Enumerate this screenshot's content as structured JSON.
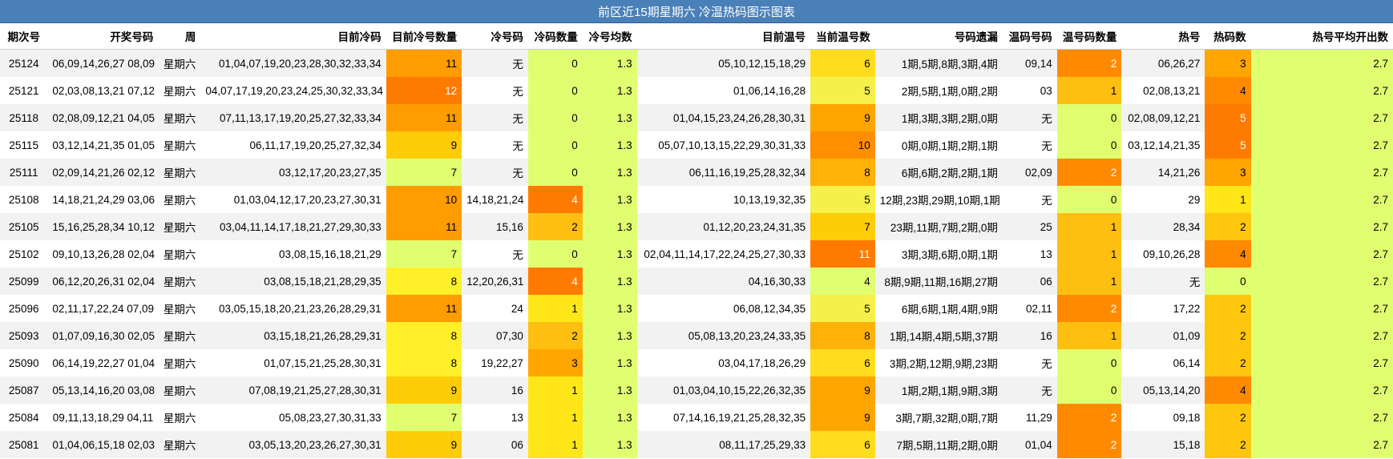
{
  "title": "前区近15期星期六 冷温热码图示图表",
  "headers": [
    "期次号",
    "开奖号码",
    "周",
    "目前冷码",
    "目前冷号数量",
    "冷号码",
    "冷码数量",
    "冷号均数",
    "目前温号",
    "当前温号数",
    "号码遗漏",
    "温码号码",
    "温号码数量",
    "热号",
    "热码数",
    "热号平均开出数"
  ],
  "colors": {
    "header_bg": "#4a80b8",
    "scale": {
      "0": "#e0ff70",
      "1": "#ffe619",
      "2": "#ffbf10",
      "3": "#ffa500",
      "4": "#ff8a00",
      "5": "#ff7b00",
      "6": "#ffdd1d",
      "7": "#e0ff70",
      "8": "#fff02a",
      "9": "#ffcc0a",
      "10": "#ff8f00",
      "11": "#ff9c00",
      "12": "#ff7900"
    },
    "avg_bg": "#e0ff70",
    "white_text_counts": [
      "12",
      "11_warm",
      "4_cold",
      "5_hot",
      "2_warm"
    ]
  },
  "rows": [
    {
      "issue": "25124",
      "draw": "06,09,14,26,27 08,09",
      "week": "星期六",
      "cold_codes": "01,04,07,19,20,23,28,30,32,33,34",
      "cold_count": "11",
      "cold_nums": "无",
      "cold_qty": "0",
      "cold_avg": "1.3",
      "warm_codes": "05,10,12,15,18,29",
      "warm_count": "6",
      "missing": "1期,5期,8期,3期,4期",
      "warm_nums": "09,14",
      "warm_qty": "2",
      "hot_nums": "06,26,27",
      "hot_count": "3",
      "hot_avg": "2.7"
    },
    {
      "issue": "25121",
      "draw": "02,03,08,13,21 07,12",
      "week": "星期六",
      "cold_codes": "04,07,17,19,20,23,24,25,30,32,33,34",
      "cold_count": "12",
      "cold_nums": "无",
      "cold_qty": "0",
      "cold_avg": "1.3",
      "warm_codes": "01,06,14,16,28",
      "warm_count": "5",
      "missing": "2期,5期,1期,0期,2期",
      "warm_nums": "03",
      "warm_qty": "1",
      "hot_nums": "02,08,13,21",
      "hot_count": "4",
      "hot_avg": "2.7"
    },
    {
      "issue": "25118",
      "draw": "02,08,09,12,21 04,05",
      "week": "星期六",
      "cold_codes": "07,11,13,17,19,20,25,27,32,33,34",
      "cold_count": "11",
      "cold_nums": "无",
      "cold_qty": "0",
      "cold_avg": "1.3",
      "warm_codes": "01,04,15,23,24,26,28,30,31",
      "warm_count": "9",
      "missing": "1期,3期,3期,2期,0期",
      "warm_nums": "无",
      "warm_qty": "0",
      "hot_nums": "02,08,09,12,21",
      "hot_count": "5",
      "hot_avg": "2.7"
    },
    {
      "issue": "25115",
      "draw": "03,12,14,21,35 01,05",
      "week": "星期六",
      "cold_codes": "06,11,17,19,20,25,27,32,34",
      "cold_count": "9",
      "cold_nums": "无",
      "cold_qty": "0",
      "cold_avg": "1.3",
      "warm_codes": "05,07,10,13,15,22,29,30,31,33",
      "warm_count": "10",
      "missing": "0期,0期,1期,2期,1期",
      "warm_nums": "无",
      "warm_qty": "0",
      "hot_nums": "03,12,14,21,35",
      "hot_count": "5",
      "hot_avg": "2.7"
    },
    {
      "issue": "25111",
      "draw": "02,09,14,21,26 02,12",
      "week": "星期六",
      "cold_codes": "03,12,17,20,23,27,35",
      "cold_count": "7",
      "cold_nums": "无",
      "cold_qty": "0",
      "cold_avg": "1.3",
      "warm_codes": "06,11,16,19,25,28,32,34",
      "warm_count": "8",
      "missing": "6期,6期,2期,2期,1期",
      "warm_nums": "02,09",
      "warm_qty": "2",
      "hot_nums": "14,21,26",
      "hot_count": "3",
      "hot_avg": "2.7"
    },
    {
      "issue": "25108",
      "draw": "14,18,21,24,29 03,06",
      "week": "星期六",
      "cold_codes": "01,03,04,12,17,20,23,27,30,31",
      "cold_count": "10",
      "cold_nums": "14,18,21,24",
      "cold_qty": "4",
      "cold_avg": "1.3",
      "warm_codes": "10,13,19,32,35",
      "warm_count": "5",
      "missing": "12期,23期,29期,10期,1期",
      "warm_nums": "无",
      "warm_qty": "0",
      "hot_nums": "29",
      "hot_count": "1",
      "hot_avg": "2.7"
    },
    {
      "issue": "25105",
      "draw": "15,16,25,28,34 10,12",
      "week": "星期六",
      "cold_codes": "03,04,11,14,17,18,21,27,29,30,33",
      "cold_count": "11",
      "cold_nums": "15,16",
      "cold_qty": "2",
      "cold_avg": "1.3",
      "warm_codes": "01,12,20,23,24,31,35",
      "warm_count": "7",
      "missing": "23期,11期,7期,2期,0期",
      "warm_nums": "25",
      "warm_qty": "1",
      "hot_nums": "28,34",
      "hot_count": "2",
      "hot_avg": "2.7"
    },
    {
      "issue": "25102",
      "draw": "09,10,13,26,28 02,04",
      "week": "星期六",
      "cold_codes": "03,08,15,16,18,21,29",
      "cold_count": "7",
      "cold_nums": "无",
      "cold_qty": "0",
      "cold_avg": "1.3",
      "warm_codes": "02,04,11,14,17,22,24,25,27,30,33",
      "warm_count": "11",
      "missing": "3期,3期,6期,0期,1期",
      "warm_nums": "13",
      "warm_qty": "1",
      "hot_nums": "09,10,26,28",
      "hot_count": "4",
      "hot_avg": "2.7"
    },
    {
      "issue": "25099",
      "draw": "06,12,20,26,31 02,04",
      "week": "星期六",
      "cold_codes": "03,08,15,18,21,28,29,35",
      "cold_count": "8",
      "cold_nums": "12,20,26,31",
      "cold_qty": "4",
      "cold_avg": "1.3",
      "warm_codes": "04,16,30,33",
      "warm_count": "4",
      "missing": "8期,9期,11期,16期,27期",
      "warm_nums": "06",
      "warm_qty": "1",
      "hot_nums": "无",
      "hot_count": "0",
      "hot_avg": "2.7"
    },
    {
      "issue": "25096",
      "draw": "02,11,17,22,24 07,09",
      "week": "星期六",
      "cold_codes": "03,05,15,18,20,21,23,26,28,29,31",
      "cold_count": "11",
      "cold_nums": "24",
      "cold_qty": "1",
      "cold_avg": "1.3",
      "warm_codes": "06,08,12,34,35",
      "warm_count": "5",
      "missing": "6期,6期,1期,4期,9期",
      "warm_nums": "02,11",
      "warm_qty": "2",
      "hot_nums": "17,22",
      "hot_count": "2",
      "hot_avg": "2.7"
    },
    {
      "issue": "25093",
      "draw": "01,07,09,16,30 02,05",
      "week": "星期六",
      "cold_codes": "03,15,18,21,26,28,29,31",
      "cold_count": "8",
      "cold_nums": "07,30",
      "cold_qty": "2",
      "cold_avg": "1.3",
      "warm_codes": "05,08,13,20,23,24,33,35",
      "warm_count": "8",
      "missing": "1期,14期,4期,5期,37期",
      "warm_nums": "16",
      "warm_qty": "1",
      "hot_nums": "01,09",
      "hot_count": "2",
      "hot_avg": "2.7"
    },
    {
      "issue": "25090",
      "draw": "06,14,19,22,27 01,04",
      "week": "星期六",
      "cold_codes": "01,07,15,21,25,28,30,31",
      "cold_count": "8",
      "cold_nums": "19,22,27",
      "cold_qty": "3",
      "cold_avg": "1.3",
      "warm_codes": "03,04,17,18,26,29",
      "warm_count": "6",
      "missing": "3期,2期,12期,9期,23期",
      "warm_nums": "无",
      "warm_qty": "0",
      "hot_nums": "06,14",
      "hot_count": "2",
      "hot_avg": "2.7"
    },
    {
      "issue": "25087",
      "draw": "05,13,14,16,20 03,08",
      "week": "星期六",
      "cold_codes": "07,08,19,21,25,27,28,30,31",
      "cold_count": "9",
      "cold_nums": "16",
      "cold_qty": "1",
      "cold_avg": "1.3",
      "warm_codes": "01,03,04,10,15,22,26,32,35",
      "warm_count": "9",
      "missing": "1期,2期,1期,9期,3期",
      "warm_nums": "无",
      "warm_qty": "0",
      "hot_nums": "05,13,14,20",
      "hot_count": "4",
      "hot_avg": "2.7"
    },
    {
      "issue": "25084",
      "draw": "09,11,13,18,29 04,11",
      "week": "星期六",
      "cold_codes": "05,08,23,27,30,31,33",
      "cold_count": "7",
      "cold_nums": "13",
      "cold_qty": "1",
      "cold_avg": "1.3",
      "warm_codes": "07,14,16,19,21,25,28,32,35",
      "warm_count": "9",
      "missing": "3期,7期,32期,0期,7期",
      "warm_nums": "11,29",
      "warm_qty": "2",
      "hot_nums": "09,18",
      "hot_count": "2",
      "hot_avg": "2.7"
    },
    {
      "issue": "25081",
      "draw": "01,04,06,15,18 02,03",
      "week": "星期六",
      "cold_codes": "03,05,13,20,23,26,27,30,31",
      "cold_count": "9",
      "cold_nums": "06",
      "cold_qty": "1",
      "cold_avg": "1.3",
      "warm_codes": "08,11,17,25,29,33",
      "warm_count": "6",
      "missing": "7期,5期,11期,2期,0期",
      "warm_nums": "01,04",
      "warm_qty": "2",
      "hot_nums": "15,18",
      "hot_count": "2",
      "hot_avg": "2.7"
    }
  ]
}
